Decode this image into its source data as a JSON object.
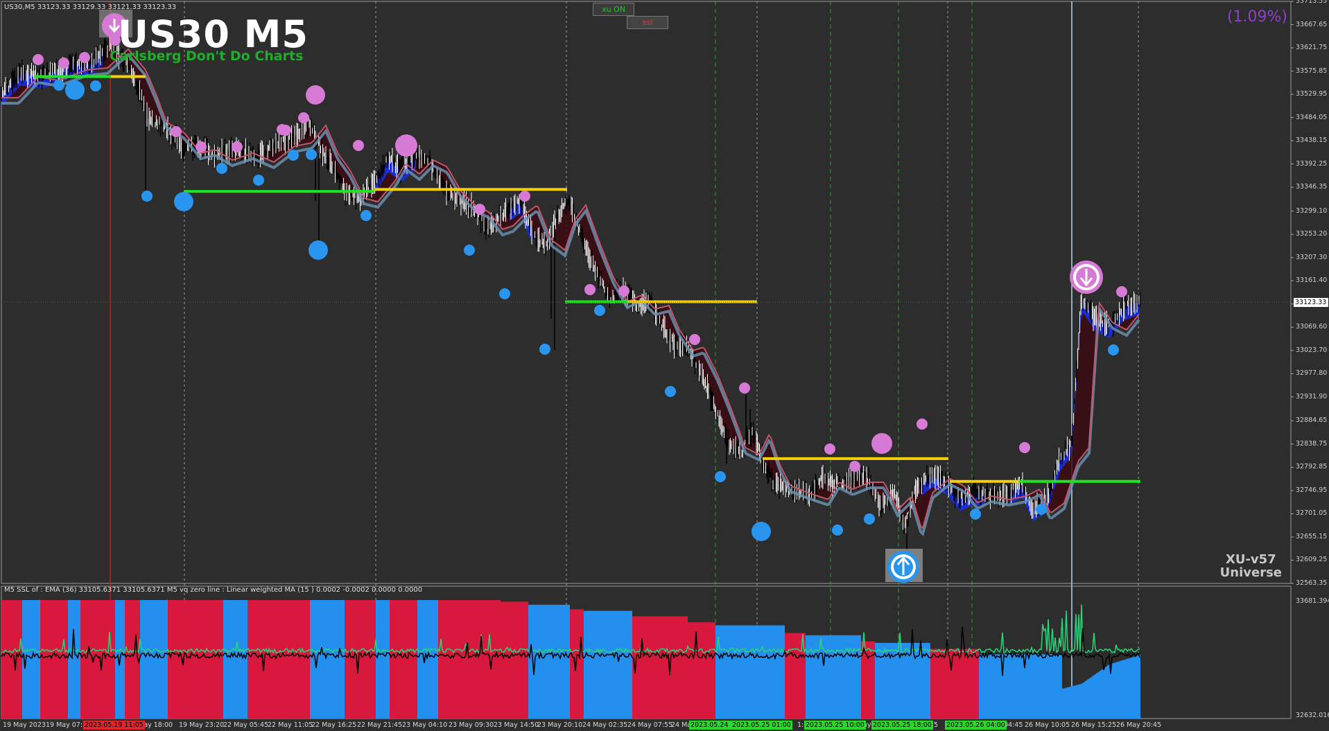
{
  "header": {
    "symbol_info": "US30,M5  33123.33 33129.33 33121.33 33123.33",
    "title": "US30 M5",
    "subtitle": "Carlsberg Don't Do Charts",
    "percent_change": "(1.09%)",
    "brand_line1": "XU-v57",
    "brand_line2": "Universe"
  },
  "buttons": {
    "xu_on": "xu ON",
    "ssl": "ssl"
  },
  "price_axis": {
    "labels": [
      "33713.55",
      "33667.65",
      "33621.75",
      "33575.85",
      "33529.95",
      "33484.05",
      "33438.15",
      "33392.25",
      "33346.35",
      "33299.10",
      "33253.20",
      "33207.30",
      "33161.40",
      "33115.50",
      "33069.60",
      "33023.70",
      "32977.80",
      "32931.90",
      "32884.65",
      "32838.75",
      "32792.85",
      "32746.95",
      "32701.05",
      "32655.15",
      "32609.25",
      "32563.35"
    ],
    "current": "33123.33",
    "indicator_top": "33681.3943",
    "indicator_bottom": "32632.0163"
  },
  "time_axis": {
    "labels": [
      "19 May 2023",
      "19 May 07:2",
      "9 May 18:00",
      "19 May 23:20",
      "22 May 05:45",
      "22 May 11:05",
      "22 May 16:25",
      "22 May 21:45",
      "23 May 04:10",
      "23 May 09:30",
      "23 May 14:50",
      "23 May 20:10",
      "24 May 02:35",
      "24 May 07:55",
      "24 May",
      "1:00",
      "ay",
      "25",
      "04:45",
      "26 May 10:05",
      "26 May 15:25",
      "26 May 20:45"
    ],
    "highlights": [
      {
        "text": "2023.05.19 11:05",
        "color": "#e0242c"
      },
      {
        "text": "2023.05.24 1",
        "color": "#29d829"
      },
      {
        "text": "2023.05.25 01:00",
        "color": "#29d829"
      },
      {
        "text": "2023.05.25 10:00",
        "color": "#29d829"
      },
      {
        "text": "2023.05.25 18:00",
        "color": "#29d829"
      },
      {
        "text": "2023.05.26 04:00",
        "color": "#29d829"
      }
    ]
  },
  "indicator": {
    "title": "M5 SSL of : EMA (36)  33105.6371 33105.6371  M5   vq zero line :   Linear weighted MA (15 ) 0.0002 -0.0002 0.0000 0.0000"
  },
  "colors": {
    "background": "#2d2d2d",
    "price_white": "#ffffff",
    "price_black": "#000000",
    "ema_bear": "#c0566a",
    "ema_bull": "#1a2fe0",
    "ssl_steel": "#6a8faf",
    "support": "#19e81b",
    "resistance": "#f3d20b",
    "swing_high": "#d67ad6",
    "swing_low": "#2a95ee",
    "ind_red": "#d8183c",
    "ind_blue": "#2390ef",
    "ind_green": "#27d67a"
  },
  "chart_data": {
    "type": "line",
    "title": "US30 M5",
    "ylim": [
      32563.35,
      33713.55
    ],
    "series": [
      {
        "name": "US30,M5",
        "x": [
          "19 May 2023",
          "19 May 07:2",
          "19 May 18:00",
          "19 May 23:20",
          "22 May 05:45",
          "22 May 11:05",
          "22 May 16:25",
          "22 May 21:45",
          "23 May 04:10",
          "23 May 09:30",
          "23 May 14:50",
          "23 May 20:10",
          "24 May 02:35",
          "24 May 07:55",
          "24 May",
          "25 May 01:00",
          "25 May 10:00",
          "25 May 18:00",
          "26 May 04:45",
          "26 May 10:05",
          "26 May 15:25",
          "26 May 20:45"
        ],
        "values": [
          33500,
          33560,
          33420,
          33390,
          33410,
          33430,
          33330,
          33350,
          33330,
          33270,
          33200,
          33130,
          33130,
          33040,
          32880,
          32750,
          32760,
          32700,
          32740,
          32720,
          33100,
          33123
        ]
      }
    ],
    "support_levels": [
      33565,
      33338,
      33120,
      32755
    ],
    "resistance_levels": [
      33565,
      33342,
      33120,
      32810,
      32765
    ]
  }
}
